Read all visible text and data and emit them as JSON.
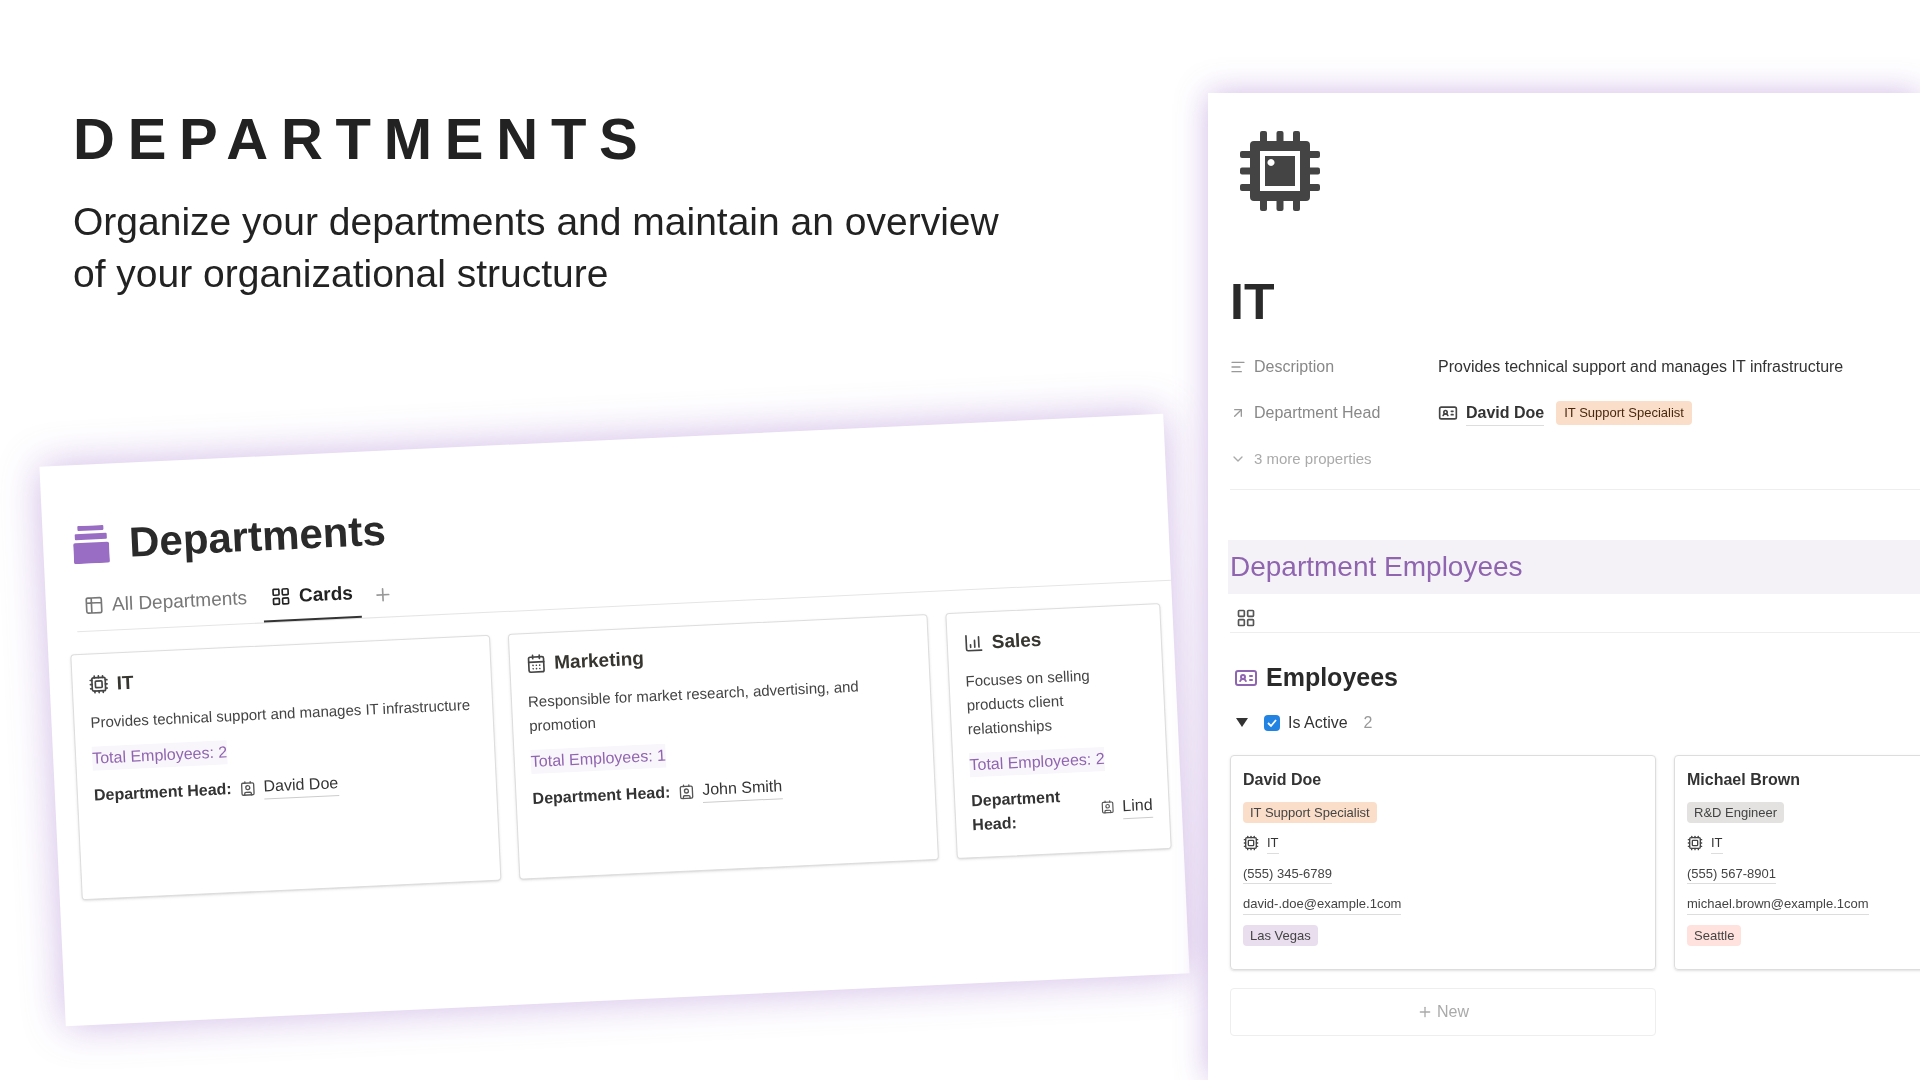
{
  "headline": {
    "title": "DEPARTMENTS",
    "subtitle": "Organize your departments and maintain an overview of your organizational structure"
  },
  "departments_page": {
    "title": "Departments",
    "tabs": [
      {
        "label": "All Departments",
        "selected": false
      },
      {
        "label": "Cards",
        "selected": true
      }
    ],
    "cards": [
      {
        "name": "IT",
        "description": "Provides technical support and manages IT infrastructure",
        "total": "Total Employees: 2",
        "head_label": "Department Head:",
        "head": "David Doe"
      },
      {
        "name": "Marketing",
        "description": "Responsible for market research, advertising, and promotion",
        "total": "Total Employees: 1",
        "head_label": "Department Head:",
        "head": "John Smith"
      },
      {
        "name": "Sales",
        "description": "Focuses on selling products client relationships",
        "total": "Total Employees: 2",
        "head_label": "Department Head:",
        "head": "Lind"
      }
    ]
  },
  "detail_page": {
    "title": "IT",
    "properties": [
      {
        "kind": "text",
        "label": "Description",
        "value": "Provides technical support and manages IT infrastructure"
      },
      {
        "kind": "relation",
        "label": "Department Head",
        "value": "David Doe",
        "tag": {
          "label": "IT Support Specialist",
          "color": "#fadec9"
        }
      }
    ],
    "more_properties": "3 more properties",
    "section_heading": "Department Employees",
    "database_title": "Employees",
    "group": {
      "label": "Is Active",
      "checked": true,
      "expanded": true,
      "count": "2"
    },
    "employees": [
      {
        "name": "David Doe",
        "role": {
          "label": "IT Support Specialist",
          "color": "#fadec9"
        },
        "department": "IT",
        "phone": "(555) 345-6789",
        "email": "david-.doe@example.1com",
        "city": {
          "label": "Las Vegas",
          "color": "#e8deee"
        }
      },
      {
        "name": "Michael Brown",
        "role": {
          "label": "R&D Engineer",
          "color": "#e3e2e0"
        },
        "department": "IT",
        "phone": "(555) 567-8901",
        "email": "michael.brown@example.1com",
        "city": {
          "label": "Seattle",
          "color": "#ffe2dd"
        }
      }
    ],
    "new_button": "New"
  }
}
